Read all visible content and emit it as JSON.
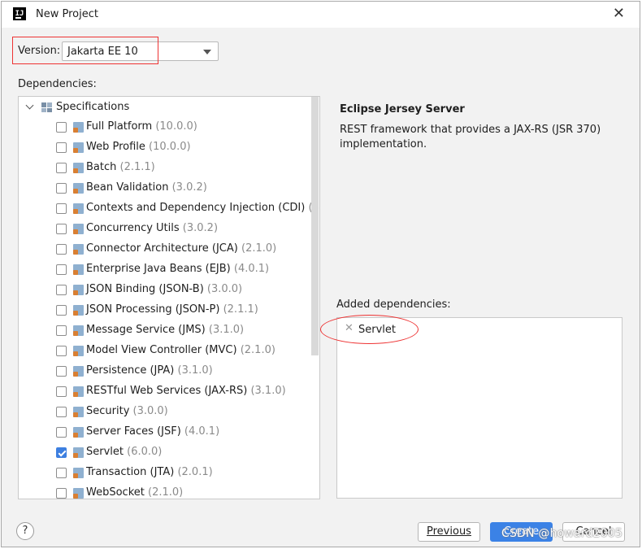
{
  "window": {
    "title": "New Project",
    "icon": "intellij-app-icon",
    "icon_text": "IJ"
  },
  "version": {
    "label": "Version:",
    "value": "Jakarta EE 10"
  },
  "dependencies": {
    "label": "Dependencies:",
    "root": {
      "label": "Specifications",
      "expanded": true
    },
    "items": [
      {
        "name": "Full Platform",
        "version": "(10.0.0)",
        "checked": false
      },
      {
        "name": "Web Profile",
        "version": "(10.0.0)",
        "checked": false
      },
      {
        "name": "Batch",
        "version": "(2.1.1)",
        "checked": false
      },
      {
        "name": "Bean Validation",
        "version": "(3.0.2)",
        "checked": false
      },
      {
        "name": "Contexts and Dependency Injection (CDI)",
        "version": "(4.0.1",
        "checked": false
      },
      {
        "name": "Concurrency Utils",
        "version": "(3.0.2)",
        "checked": false
      },
      {
        "name": "Connector Architecture (JCA)",
        "version": "(2.1.0)",
        "checked": false
      },
      {
        "name": "Enterprise Java Beans (EJB)",
        "version": "(4.0.1)",
        "checked": false
      },
      {
        "name": "JSON Binding (JSON-B)",
        "version": "(3.0.0)",
        "checked": false
      },
      {
        "name": "JSON Processing (JSON-P)",
        "version": "(2.1.1)",
        "checked": false
      },
      {
        "name": "Message Service (JMS)",
        "version": "(3.1.0)",
        "checked": false
      },
      {
        "name": "Model View Controller (MVC)",
        "version": "(2.1.0)",
        "checked": false
      },
      {
        "name": "Persistence (JPA)",
        "version": "(3.1.0)",
        "checked": false
      },
      {
        "name": "RESTful Web Services (JAX-RS)",
        "version": "(3.1.0)",
        "checked": false
      },
      {
        "name": "Security",
        "version": "(3.0.0)",
        "checked": false
      },
      {
        "name": "Server Faces (JSF)",
        "version": "(4.0.1)",
        "checked": false
      },
      {
        "name": "Servlet",
        "version": "(6.0.0)",
        "checked": true
      },
      {
        "name": "Transaction (JTA)",
        "version": "(2.0.1)",
        "checked": false
      },
      {
        "name": "WebSocket",
        "version": "(2.1.0)",
        "checked": false
      }
    ]
  },
  "detail": {
    "title": "Eclipse Jersey Server",
    "description": "REST framework that provides a JAX-RS (JSR 370) implementation."
  },
  "added": {
    "label": "Added dependencies:",
    "items": [
      {
        "name": "Servlet",
        "remove_icon": "close-icon"
      }
    ]
  },
  "buttons": {
    "help": "?",
    "previous": "Previous",
    "create": "Create",
    "cancel": "Cancel"
  },
  "watermark": "CSDN @howard2005",
  "colors": {
    "accent": "#3b82e6",
    "annotation": "#e33333",
    "checked": "#3d7fe0"
  }
}
